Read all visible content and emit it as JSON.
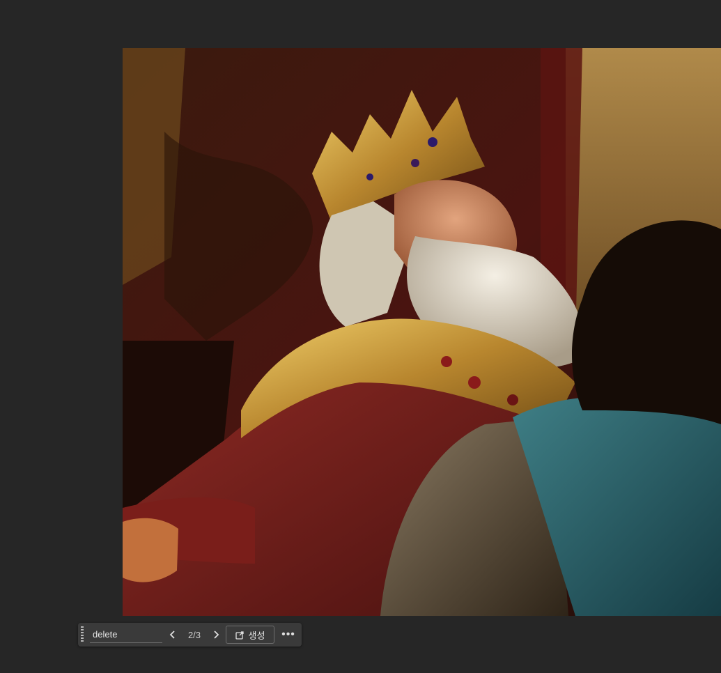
{
  "canvas": {
    "background": "#262626"
  },
  "image": {
    "subject_icon": "king-portrait-image"
  },
  "toolbar": {
    "prompt_value": "delete",
    "prev_icon": "chevron-left-icon",
    "counter": "2/3",
    "next_icon": "chevron-right-icon",
    "generate_icon": "external-generate-icon",
    "generate_label": "생성",
    "more_label": "•••",
    "more_icon": "more-icon"
  }
}
